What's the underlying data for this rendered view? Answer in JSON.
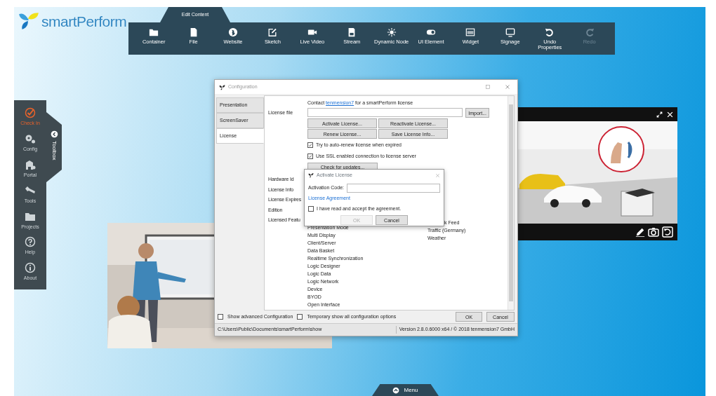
{
  "logo": {
    "text": "smartPerform"
  },
  "toolbar": {
    "tab": "Edit Content",
    "items": [
      {
        "kind": "folder",
        "label": "Container",
        "disabled": false
      },
      {
        "kind": "file",
        "label": "File",
        "disabled": false
      },
      {
        "kind": "globe",
        "label": "Website",
        "disabled": false
      },
      {
        "kind": "sketch",
        "label": "Sketch",
        "disabled": false
      },
      {
        "kind": "video",
        "label": "Live Video",
        "disabled": false
      },
      {
        "kind": "save",
        "label": "Stream",
        "disabled": false
      },
      {
        "kind": "burst",
        "label": "Dynamic Node",
        "disabled": false
      },
      {
        "kind": "toggle",
        "label": "UI Element",
        "disabled": false
      },
      {
        "kind": "widget",
        "label": "Widget",
        "disabled": false
      },
      {
        "kind": "monitor",
        "label": "Signage",
        "disabled": false
      },
      {
        "kind": "undo",
        "label": "Undo Properties",
        "disabled": false
      },
      {
        "kind": "redo",
        "label": "Redo",
        "disabled": true
      }
    ]
  },
  "sidebar": {
    "tab": "Toolbox",
    "items": [
      {
        "kind": "check",
        "label": "Check In",
        "selected": true
      },
      {
        "kind": "gears",
        "label": "Config",
        "selected": false
      },
      {
        "kind": "portal",
        "label": "Portal",
        "selected": false
      },
      {
        "kind": "wrench",
        "label": "Tools",
        "selected": false
      },
      {
        "kind": "folder",
        "label": "Projects",
        "selected": false
      },
      {
        "kind": "help",
        "label": "Help",
        "selected": false
      },
      {
        "kind": "info",
        "label": "About",
        "selected": false
      }
    ]
  },
  "config": {
    "title": "Configuration",
    "tabs": [
      {
        "label": "Presentation",
        "selected": false
      },
      {
        "label": "ScreenSaver",
        "selected": false
      },
      {
        "label": "License",
        "selected": true
      }
    ],
    "contact": {
      "before": "Contact",
      "link": "tenmension7",
      "after": "for a smartPerform license"
    },
    "license_file": {
      "label": "License file",
      "button": "Import..."
    },
    "buttons": [
      "Activate License...",
      "Reactivate License...",
      "Renew License...",
      "Save License Info..."
    ],
    "options": [
      {
        "label": "Try to auto-renew license when expired",
        "checked": true
      },
      {
        "label": "Use SSL enabled connection to license server",
        "checked": true
      }
    ],
    "update_button": "Check for updates...",
    "fields": [
      "Hardware Id",
      "License Info",
      "License Expires",
      "Edition",
      "Licensed Featu"
    ],
    "features": [
      "Presentation Mode",
      "Multi Display",
      "Client/Server",
      "Data Basket",
      "Realtime Synchronization",
      "Logic Designer",
      "Logic Data",
      "Logic Network",
      "Device",
      "BYOD",
      "Open Interface"
    ],
    "features_2": [
      "k Feed",
      "Traffic (Germany)",
      "Weather"
    ],
    "footer_options": [
      {
        "label": "Show advanced Configuration",
        "checked": false
      },
      {
        "label": "Temporary show all configuration options",
        "checked": false
      }
    ],
    "ok": "OK",
    "cancel": "Cancel",
    "status_path": "C:\\Users\\Public\\Documents\\smartPerform\\show",
    "status_version": "Version 2.8.0.6000 x64 / © 2018 tenmension7 GmbH"
  },
  "activate": {
    "title": "Activate License",
    "code_label": "Activation Code:",
    "agreement_link": "License Agreement",
    "accept": {
      "label": "I have read and accept the agreement.",
      "checked": false
    },
    "ok": {
      "label": "OK",
      "disabled": true
    },
    "cancel": "Cancel"
  },
  "menu": {
    "label": "Menu"
  }
}
